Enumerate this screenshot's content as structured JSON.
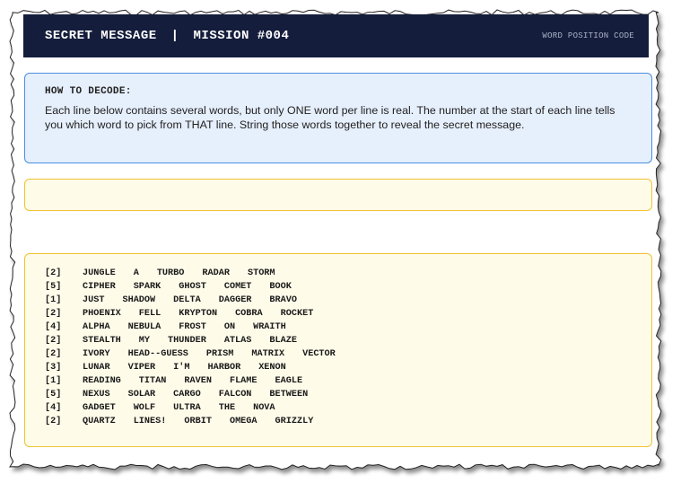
{
  "header": {
    "title": "SECRET MESSAGE",
    "separator": "|",
    "mission": "MISSION #004",
    "tag": "WORD POSITION CODE"
  },
  "instructions": {
    "label": "HOW TO DECODE:",
    "text": "Each line below contains several words, but only ONE word per line is real. The number at the start of each line tells you which word to pick from THAT line. String those words together to reveal the secret message."
  },
  "answer_box": {
    "value": ""
  },
  "lines": [
    {
      "position": "[2]",
      "words": [
        "JUNGLE",
        "A",
        "TURBO",
        "RADAR",
        "STORM"
      ]
    },
    {
      "position": "[5]",
      "words": [
        "CIPHER",
        "SPARK",
        "GHOST",
        "COMET",
        "BOOK"
      ]
    },
    {
      "position": "[1]",
      "words": [
        "JUST",
        "SHADOW",
        "DELTA",
        "DAGGER",
        "BRAVO"
      ]
    },
    {
      "position": "[2]",
      "words": [
        "PHOENIX",
        "FELL",
        "KRYPTON",
        "COBRA",
        "ROCKET"
      ]
    },
    {
      "position": "[4]",
      "words": [
        "ALPHA",
        "NEBULA",
        "FROST",
        "ON",
        "WRAITH"
      ]
    },
    {
      "position": "[2]",
      "words": [
        "STEALTH",
        "MY",
        "THUNDER",
        "ATLAS",
        "BLAZE"
      ]
    },
    {
      "position": "[2]",
      "words": [
        "IVORY",
        "HEAD--GUESS",
        "PRISM",
        "MATRIX",
        "VECTOR"
      ]
    },
    {
      "position": "[3]",
      "words": [
        "LUNAR",
        "VIPER",
        "I'M",
        "HARBOR",
        "XENON"
      ]
    },
    {
      "position": "[1]",
      "words": [
        "READING",
        "TITAN",
        "RAVEN",
        "FLAME",
        "EAGLE"
      ]
    },
    {
      "position": "[5]",
      "words": [
        "NEXUS",
        "SOLAR",
        "CARGO",
        "FALCON",
        "BETWEEN"
      ]
    },
    {
      "position": "[4]",
      "words": [
        "GADGET",
        "WOLF",
        "ULTRA",
        "THE",
        "NOVA"
      ]
    },
    {
      "position": "[2]",
      "words": [
        "QUARTZ",
        "LINES!",
        "ORBIT",
        "OMEGA",
        "GRIZZLY"
      ]
    }
  ]
}
